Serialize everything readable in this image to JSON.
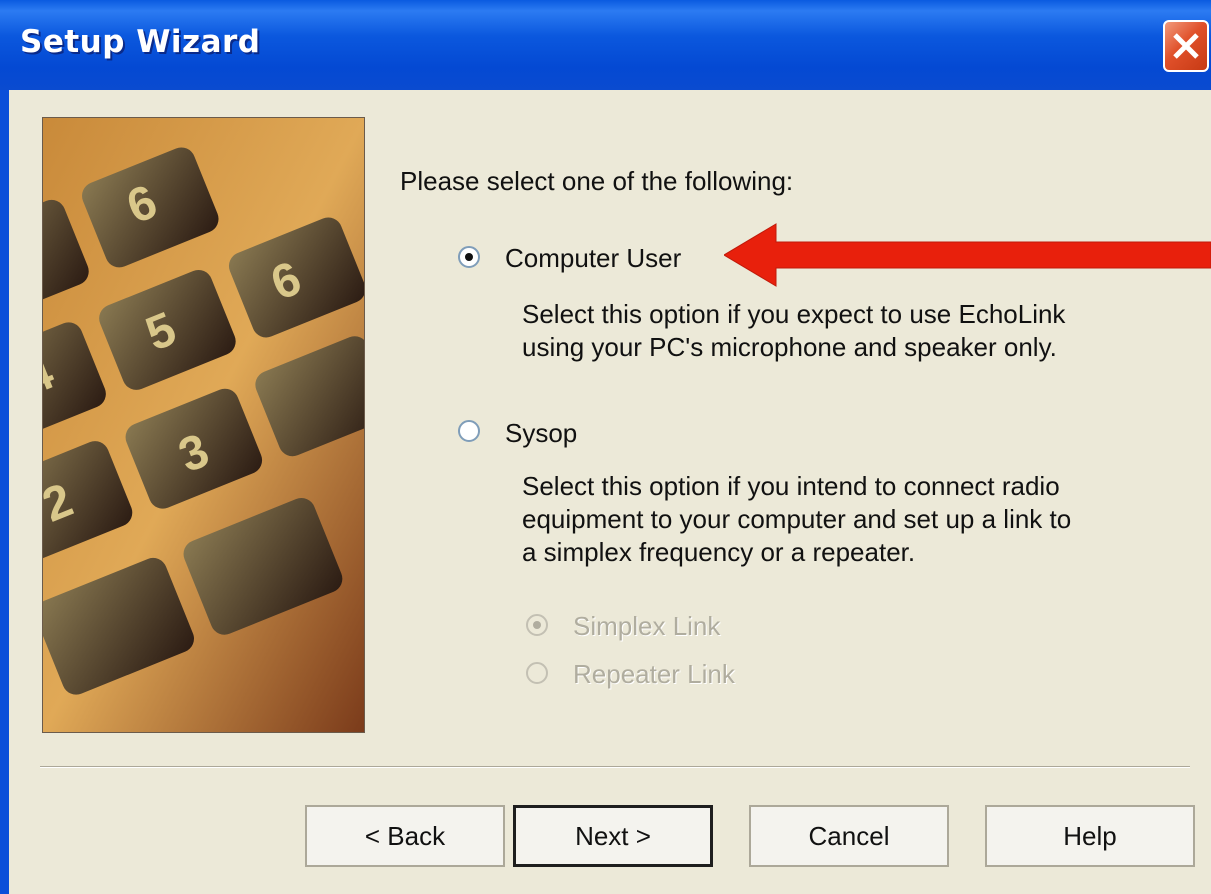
{
  "window": {
    "title": "Setup Wizard"
  },
  "prompt": "Please select one of the following:",
  "options": [
    {
      "label": "Computer User",
      "selected": true,
      "description": [
        "Select this option if you expect to use EchoLink",
        "using your PC's microphone and speaker only."
      ]
    },
    {
      "label": "Sysop",
      "selected": false,
      "description": [
        "Select this option if you intend to connect radio",
        "equipment to your computer and set up a link to",
        "a simplex frequency or a repeater."
      ]
    }
  ],
  "sub_options": [
    {
      "label": "Simplex Link",
      "selected": true,
      "enabled": false
    },
    {
      "label": "Repeater Link",
      "selected": false,
      "enabled": false
    }
  ],
  "buttons": {
    "back": "< Back",
    "next": "Next >",
    "cancel": "Cancel",
    "help": "Help"
  },
  "annotation": {
    "arrow_color": "#e8200c",
    "points_to": "Computer User"
  },
  "colors": {
    "titlebar": "#0b58de",
    "dialog_bg": "#ece9d8"
  }
}
